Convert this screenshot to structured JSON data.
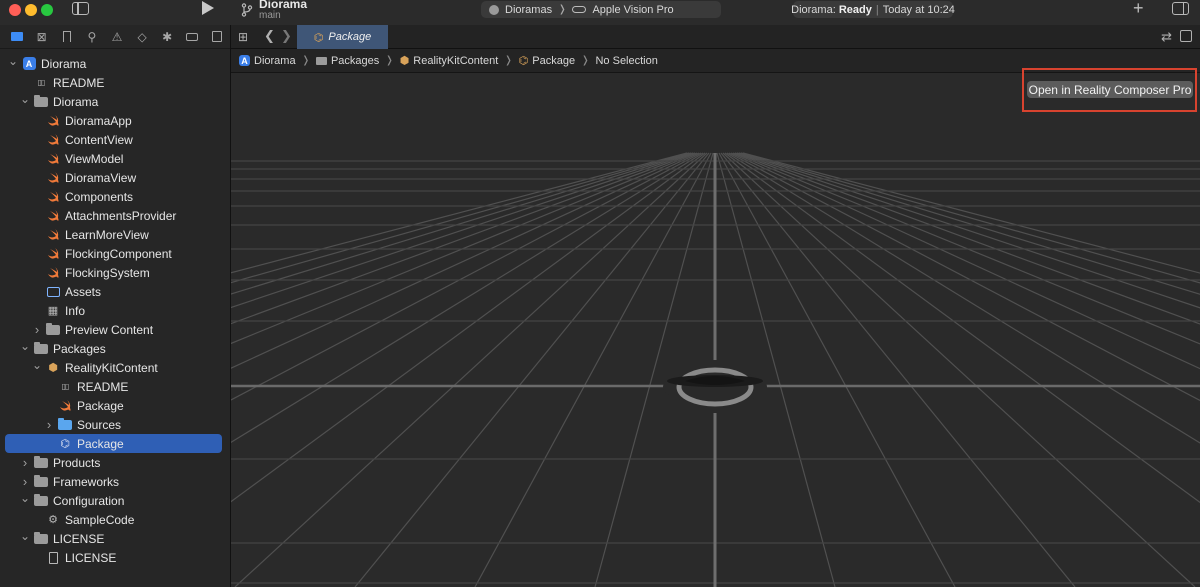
{
  "toolbar": {
    "project_title": "Diorama",
    "branch": "main",
    "scheme_target": "Dioramas",
    "scheme_device": "Apple Vision Pro",
    "status_project": "Diorama:",
    "status_state": "Ready",
    "status_time": "Today at 10:24",
    "plus_label": "+",
    "run_label": "run-icon"
  },
  "navigator": {
    "tabs": [
      "folder-icon",
      "source-control-icon",
      "bookmark-icon",
      "search-icon",
      "warning-icon",
      "test-icon",
      "debug-icon",
      "breakpoint-icon",
      "report-icon"
    ],
    "tree": [
      {
        "label": "Diorama",
        "icon": "project-icon",
        "level": 0,
        "disclosure": "open"
      },
      {
        "label": "README",
        "icon": "book-icon",
        "level": 1,
        "disclosure": "none"
      },
      {
        "label": "Diorama",
        "icon": "folder-icon",
        "level": 1,
        "disclosure": "open"
      },
      {
        "label": "DioramaApp",
        "icon": "swift-icon",
        "level": 2,
        "disclosure": "none"
      },
      {
        "label": "ContentView",
        "icon": "swift-icon",
        "level": 2,
        "disclosure": "none"
      },
      {
        "label": "ViewModel",
        "icon": "swift-icon",
        "level": 2,
        "disclosure": "none"
      },
      {
        "label": "DioramaView",
        "icon": "swift-icon",
        "level": 2,
        "disclosure": "none"
      },
      {
        "label": "Components",
        "icon": "swift-icon",
        "level": 2,
        "disclosure": "none"
      },
      {
        "label": "AttachmentsProvider",
        "icon": "swift-icon",
        "level": 2,
        "disclosure": "none"
      },
      {
        "label": "LearnMoreView",
        "icon": "swift-icon",
        "level": 2,
        "disclosure": "none"
      },
      {
        "label": "FlockingComponent",
        "icon": "swift-icon",
        "level": 2,
        "disclosure": "none"
      },
      {
        "label": "FlockingSystem",
        "icon": "swift-icon",
        "level": 2,
        "disclosure": "none"
      },
      {
        "label": "Assets",
        "icon": "assets-icon",
        "level": 2,
        "disclosure": "none"
      },
      {
        "label": "Info",
        "icon": "table-icon",
        "level": 2,
        "disclosure": "none"
      },
      {
        "label": "Preview Content",
        "icon": "folder-icon",
        "level": 2,
        "disclosure": "closed"
      },
      {
        "label": "Packages",
        "icon": "folder-icon",
        "level": 1,
        "disclosure": "open"
      },
      {
        "label": "RealityKitContent",
        "icon": "package-icon",
        "level": 2,
        "disclosure": "open"
      },
      {
        "label": "README",
        "icon": "book-icon",
        "level": 3,
        "disclosure": "none"
      },
      {
        "label": "Package",
        "icon": "swift-icon",
        "level": 3,
        "disclosure": "none"
      },
      {
        "label": "Sources",
        "icon": "blue-folder-icon",
        "level": 3,
        "disclosure": "closed"
      },
      {
        "label": "Package",
        "icon": "reality-package-icon",
        "level": 3,
        "disclosure": "none",
        "selected": true
      },
      {
        "label": "Products",
        "icon": "folder-icon",
        "level": 1,
        "disclosure": "closed"
      },
      {
        "label": "Frameworks",
        "icon": "folder-icon",
        "level": 1,
        "disclosure": "closed"
      },
      {
        "label": "Configuration",
        "icon": "folder-icon",
        "level": 1,
        "disclosure": "open"
      },
      {
        "label": "SampleCode",
        "icon": "gear-icon",
        "level": 2,
        "disclosure": "none"
      },
      {
        "label": "LICENSE",
        "icon": "folder-icon",
        "level": 1,
        "disclosure": "open"
      },
      {
        "label": "LICENSE",
        "icon": "document-icon",
        "level": 2,
        "disclosure": "none"
      }
    ]
  },
  "editor": {
    "tab_label": "Package",
    "breadcrumb": [
      {
        "label": "Diorama",
        "icon": "project-icon"
      },
      {
        "label": "Packages",
        "icon": "folder-icon"
      },
      {
        "label": "RealityKitContent",
        "icon": "package-icon"
      },
      {
        "label": "Package",
        "icon": "reality-package-icon"
      },
      {
        "label": "No Selection",
        "icon": ""
      }
    ],
    "open_button_label": "Open in Reality Composer Pro"
  },
  "colors": {
    "accent": "#2f5fb5",
    "tab_active": "#3f5677",
    "highlight": "#d8432f",
    "swift": "#f07a3a"
  }
}
